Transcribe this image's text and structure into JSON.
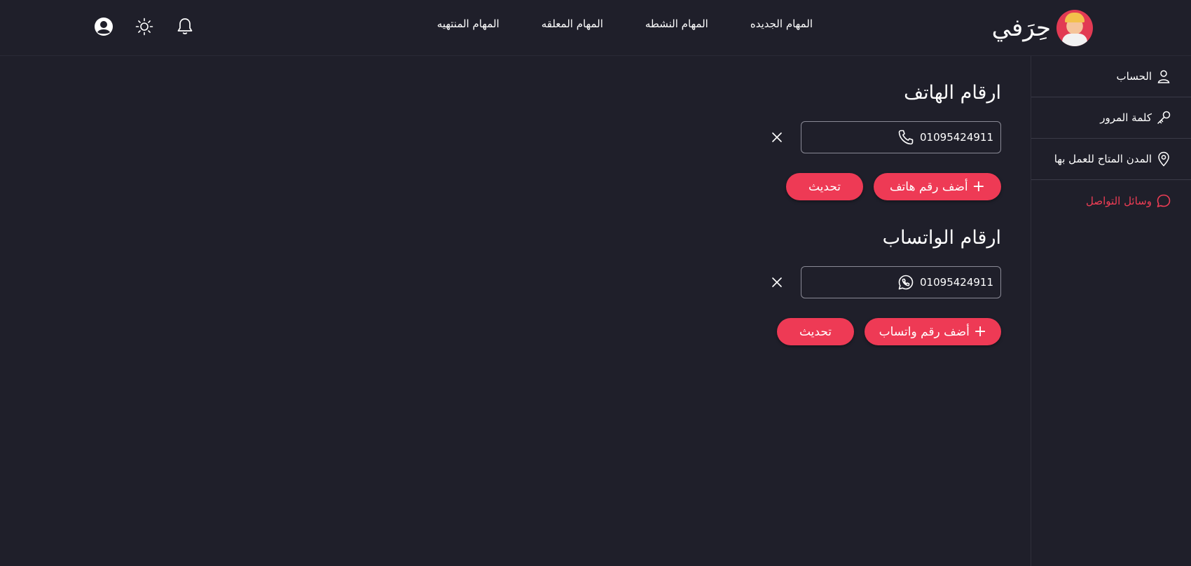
{
  "brand": {
    "name": "حِرَفي"
  },
  "topnav": [
    {
      "label": "المهام الجديده"
    },
    {
      "label": "المهام النشطه"
    },
    {
      "label": "المهام المعلقه"
    },
    {
      "label": "المهام المنتهيه"
    }
  ],
  "sidebar": {
    "items": [
      {
        "label": "الحساب",
        "icon": "user-icon"
      },
      {
        "label": "كلمة المرور",
        "icon": "key-icon"
      },
      {
        "label": "المدن المتاح للعمل بها",
        "icon": "location-pin-icon"
      },
      {
        "label": "وسائل التواصل",
        "icon": "chat-bubble-icon",
        "active": true
      }
    ]
  },
  "phones": {
    "title": "ارقام الهاتف",
    "numbers": [
      "01095424911"
    ],
    "add_label": "أضف رقم هاتف",
    "update_label": "تحديث"
  },
  "whatsapp": {
    "title": "ارقام الواتساب",
    "numbers": [
      "01095424911"
    ],
    "add_label": "أضف رقم واتساب",
    "update_label": "تحديث"
  },
  "colors": {
    "background": "#1f1f2a",
    "accent": "#ee3a55",
    "text": "#ffffff"
  }
}
